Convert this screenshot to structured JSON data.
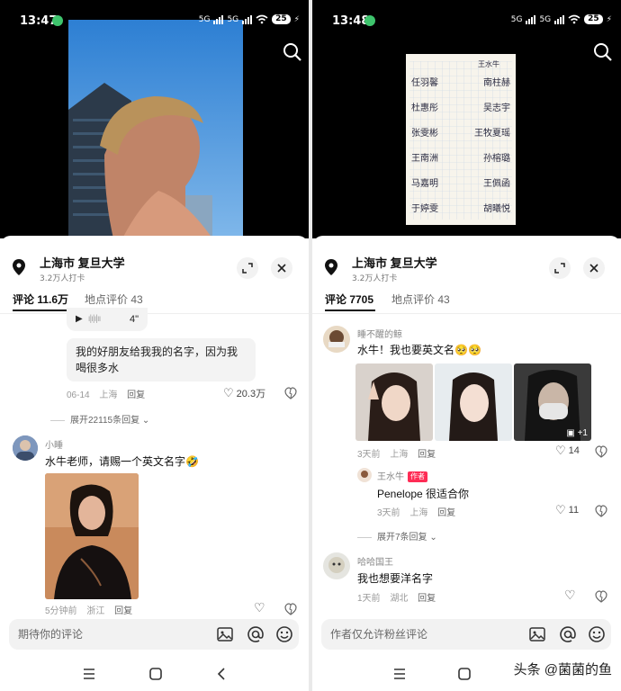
{
  "left": {
    "status": {
      "time": "13:47",
      "battery": "25",
      "net1": "5G",
      "net2": "5G"
    },
    "location": {
      "title": "上海市  复旦大学",
      "checkins": "3.2万人打卡"
    },
    "tabs": [
      {
        "label": "评论 11.6万"
      },
      {
        "label": "地点评价 43"
      }
    ],
    "voice": {
      "duration": "4\""
    },
    "comment1": {
      "text_line1": "我的好朋友给我我的名字，因为我",
      "text_line2": "喝很多水",
      "date": "06-14",
      "place": "上海",
      "reply": "回复",
      "likes": "20.3万",
      "expand": "展开22115条回复"
    },
    "comment2": {
      "user": "小睡",
      "text": "水牛老师，请赐一个英文名字🤣",
      "time": "5分钟前",
      "place": "浙江",
      "reply": "回复"
    },
    "input": {
      "placeholder": "期待你的评论"
    }
  },
  "right": {
    "status": {
      "time": "13:48",
      "battery": "25",
      "net1": "5G",
      "net2": "5G"
    },
    "location": {
      "title": "上海市  复旦大学",
      "checkins": "3.2万人打卡"
    },
    "tabs": [
      {
        "label": "评论 7705"
      },
      {
        "label": "地点评价 43"
      }
    ],
    "comment1": {
      "user": "睡不醒的鲸",
      "text": "水牛！我也要英文名🥺🥺",
      "time": "3天前",
      "place": "上海",
      "reply": "回复",
      "likes": "14",
      "more_images": "+1"
    },
    "reply1": {
      "user": "王水牛",
      "badge": "作者",
      "text": "Penelope 很适合你",
      "time": "3天前",
      "place": "上海",
      "reply": "回复",
      "likes": "11",
      "expand": "展开7条回复"
    },
    "comment2": {
      "user": "哈哈国王",
      "text": "我也想要洋名字",
      "time": "1天前",
      "place": "湖北",
      "reply": "回复"
    },
    "input": {
      "placeholder": "作者仅允许粉丝评论"
    }
  },
  "paper_names": [
    "任羽馨",
    "南柱赫",
    "杜惠彤",
    "吴志宇",
    "张雯彬",
    "王牧夏瑶",
    "王南洲",
    "孙榕璐",
    "马嘉明",
    "王佩函",
    "于婷雯",
    "胡曦悦"
  ],
  "paper_header": "王水牛",
  "watermark": "头条 @菌菌的鱼",
  "colors": {
    "accent": "#fe2c55",
    "wechat": "#3ec46d"
  }
}
